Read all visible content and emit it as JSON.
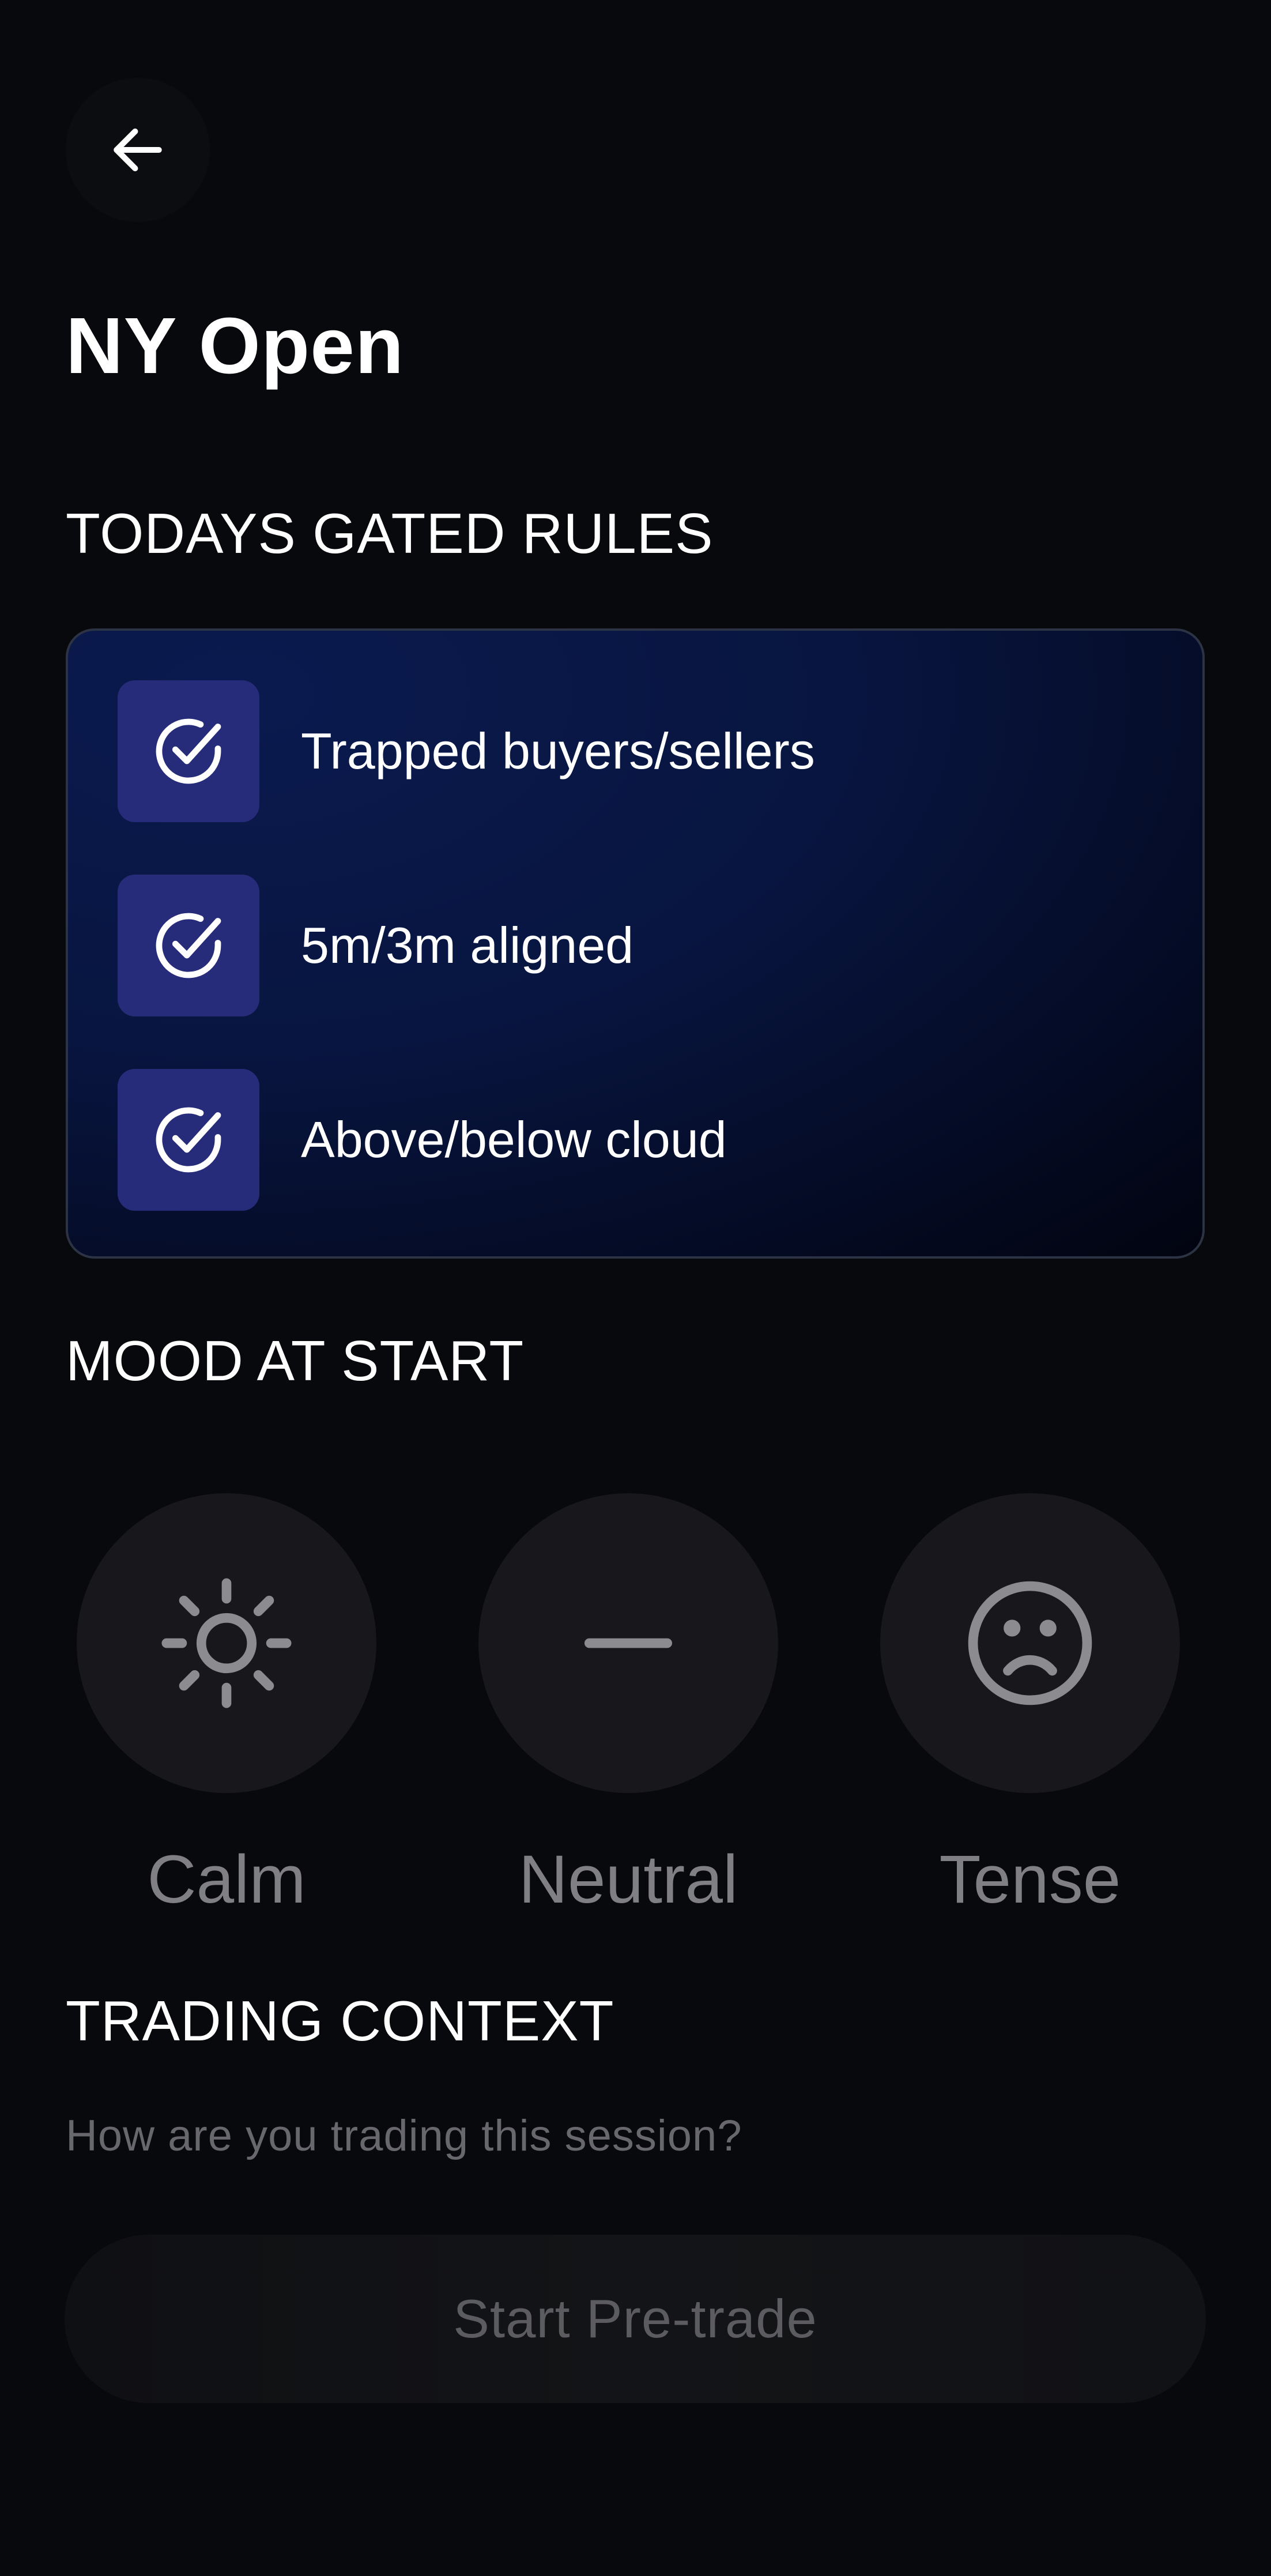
{
  "header": {
    "back_icon": "arrow-left-icon",
    "title": "NY Open"
  },
  "rules_section": {
    "title": "TODAYS GATED RULES",
    "check_icon": "check-circle-icon",
    "rules": [
      {
        "label": "Trapped buyers/sellers",
        "checked": true
      },
      {
        "label": "5m/3m aligned",
        "checked": true
      },
      {
        "label": "Above/below cloud",
        "checked": true
      }
    ]
  },
  "mood_section": {
    "title": "MOOD AT START",
    "options": [
      {
        "label": "Calm",
        "icon": "sun-icon"
      },
      {
        "label": "Neutral",
        "icon": "minus-icon"
      },
      {
        "label": "Tense",
        "icon": "frown-face-icon"
      }
    ]
  },
  "context_section": {
    "title": "TRADING CONTEXT",
    "question": "How are you trading this session?"
  },
  "start_button": {
    "label": "Start Pre-trade",
    "enabled": false
  },
  "colors": {
    "background": "#08090c",
    "card_gradient_start": "#0b1a4f",
    "check_tile": "#262c7a",
    "mood_circle": "#18181c",
    "muted_text": "#808084"
  }
}
